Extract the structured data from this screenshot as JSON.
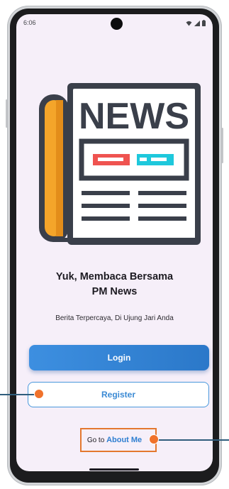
{
  "status_bar": {
    "time": "6:06",
    "icons": [
      "wifi-icon",
      "signal-icon",
      "battery-icon"
    ]
  },
  "logo": {
    "text": "NEWS",
    "colors": {
      "frame": "#3a3f4a",
      "spine": "#f4a52a",
      "paper": "#ffffff",
      "red_bar": "#ef5350",
      "cyan_bar": "#1ec8dc"
    }
  },
  "welcome": {
    "headline_line1": "Yuk, Membaca Bersama",
    "headline_line2": "PM News",
    "tagline": "Berita Terpercaya, Di Ujung Jari Anda"
  },
  "actions": {
    "login_label": "Login",
    "register_label": "Register"
  },
  "about": {
    "prefix": "Go to",
    "link_label": "About Me"
  },
  "colors": {
    "screen_background": "#f6eff9",
    "primary": "#3a8ad8",
    "annotation": "#f0722b",
    "annotation_line": "#2f5d7c"
  }
}
